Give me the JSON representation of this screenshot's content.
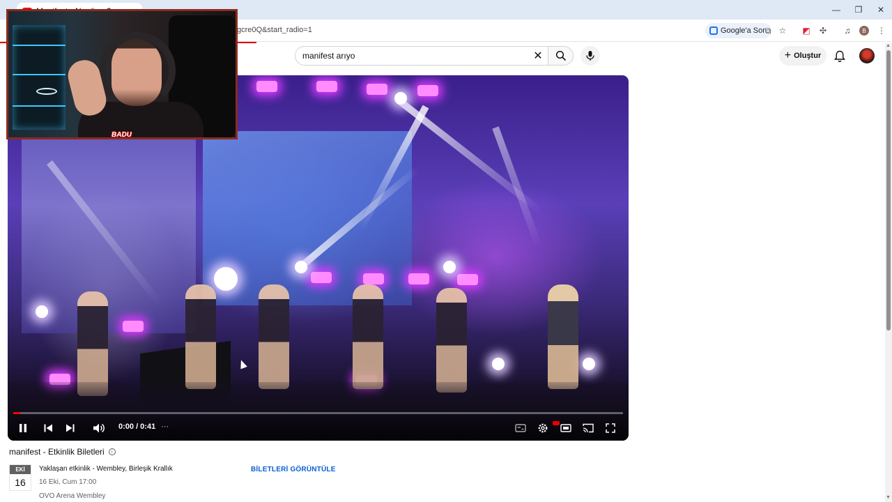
{
  "browser": {
    "tab_title": "Manifest - Ne diyor?...",
    "url_fragment": "gcre0Q&start_radio=1",
    "ask_google_label": "Google'a Sor",
    "profile_initial": "B"
  },
  "youtube": {
    "search_query": "manifest arıyo",
    "create_label": "Oluştur"
  },
  "player": {
    "time_display": "0:00 / 0:41",
    "progress_fraction": 0.0
  },
  "webcam": {
    "logo_text": "BADU"
  },
  "tickets": {
    "title": "manifest - Etkinlik Biletleri",
    "month": "EKİ",
    "day": "16",
    "event_line": "Yaklaşan etkinlik - Wembley, Birleşik Krallık",
    "datetime": "16 Eki, Cum 17:00",
    "venue": "OVO Arena Wembley",
    "cta_label": "BİLETLERİ GÖRÜNTÜLE"
  }
}
